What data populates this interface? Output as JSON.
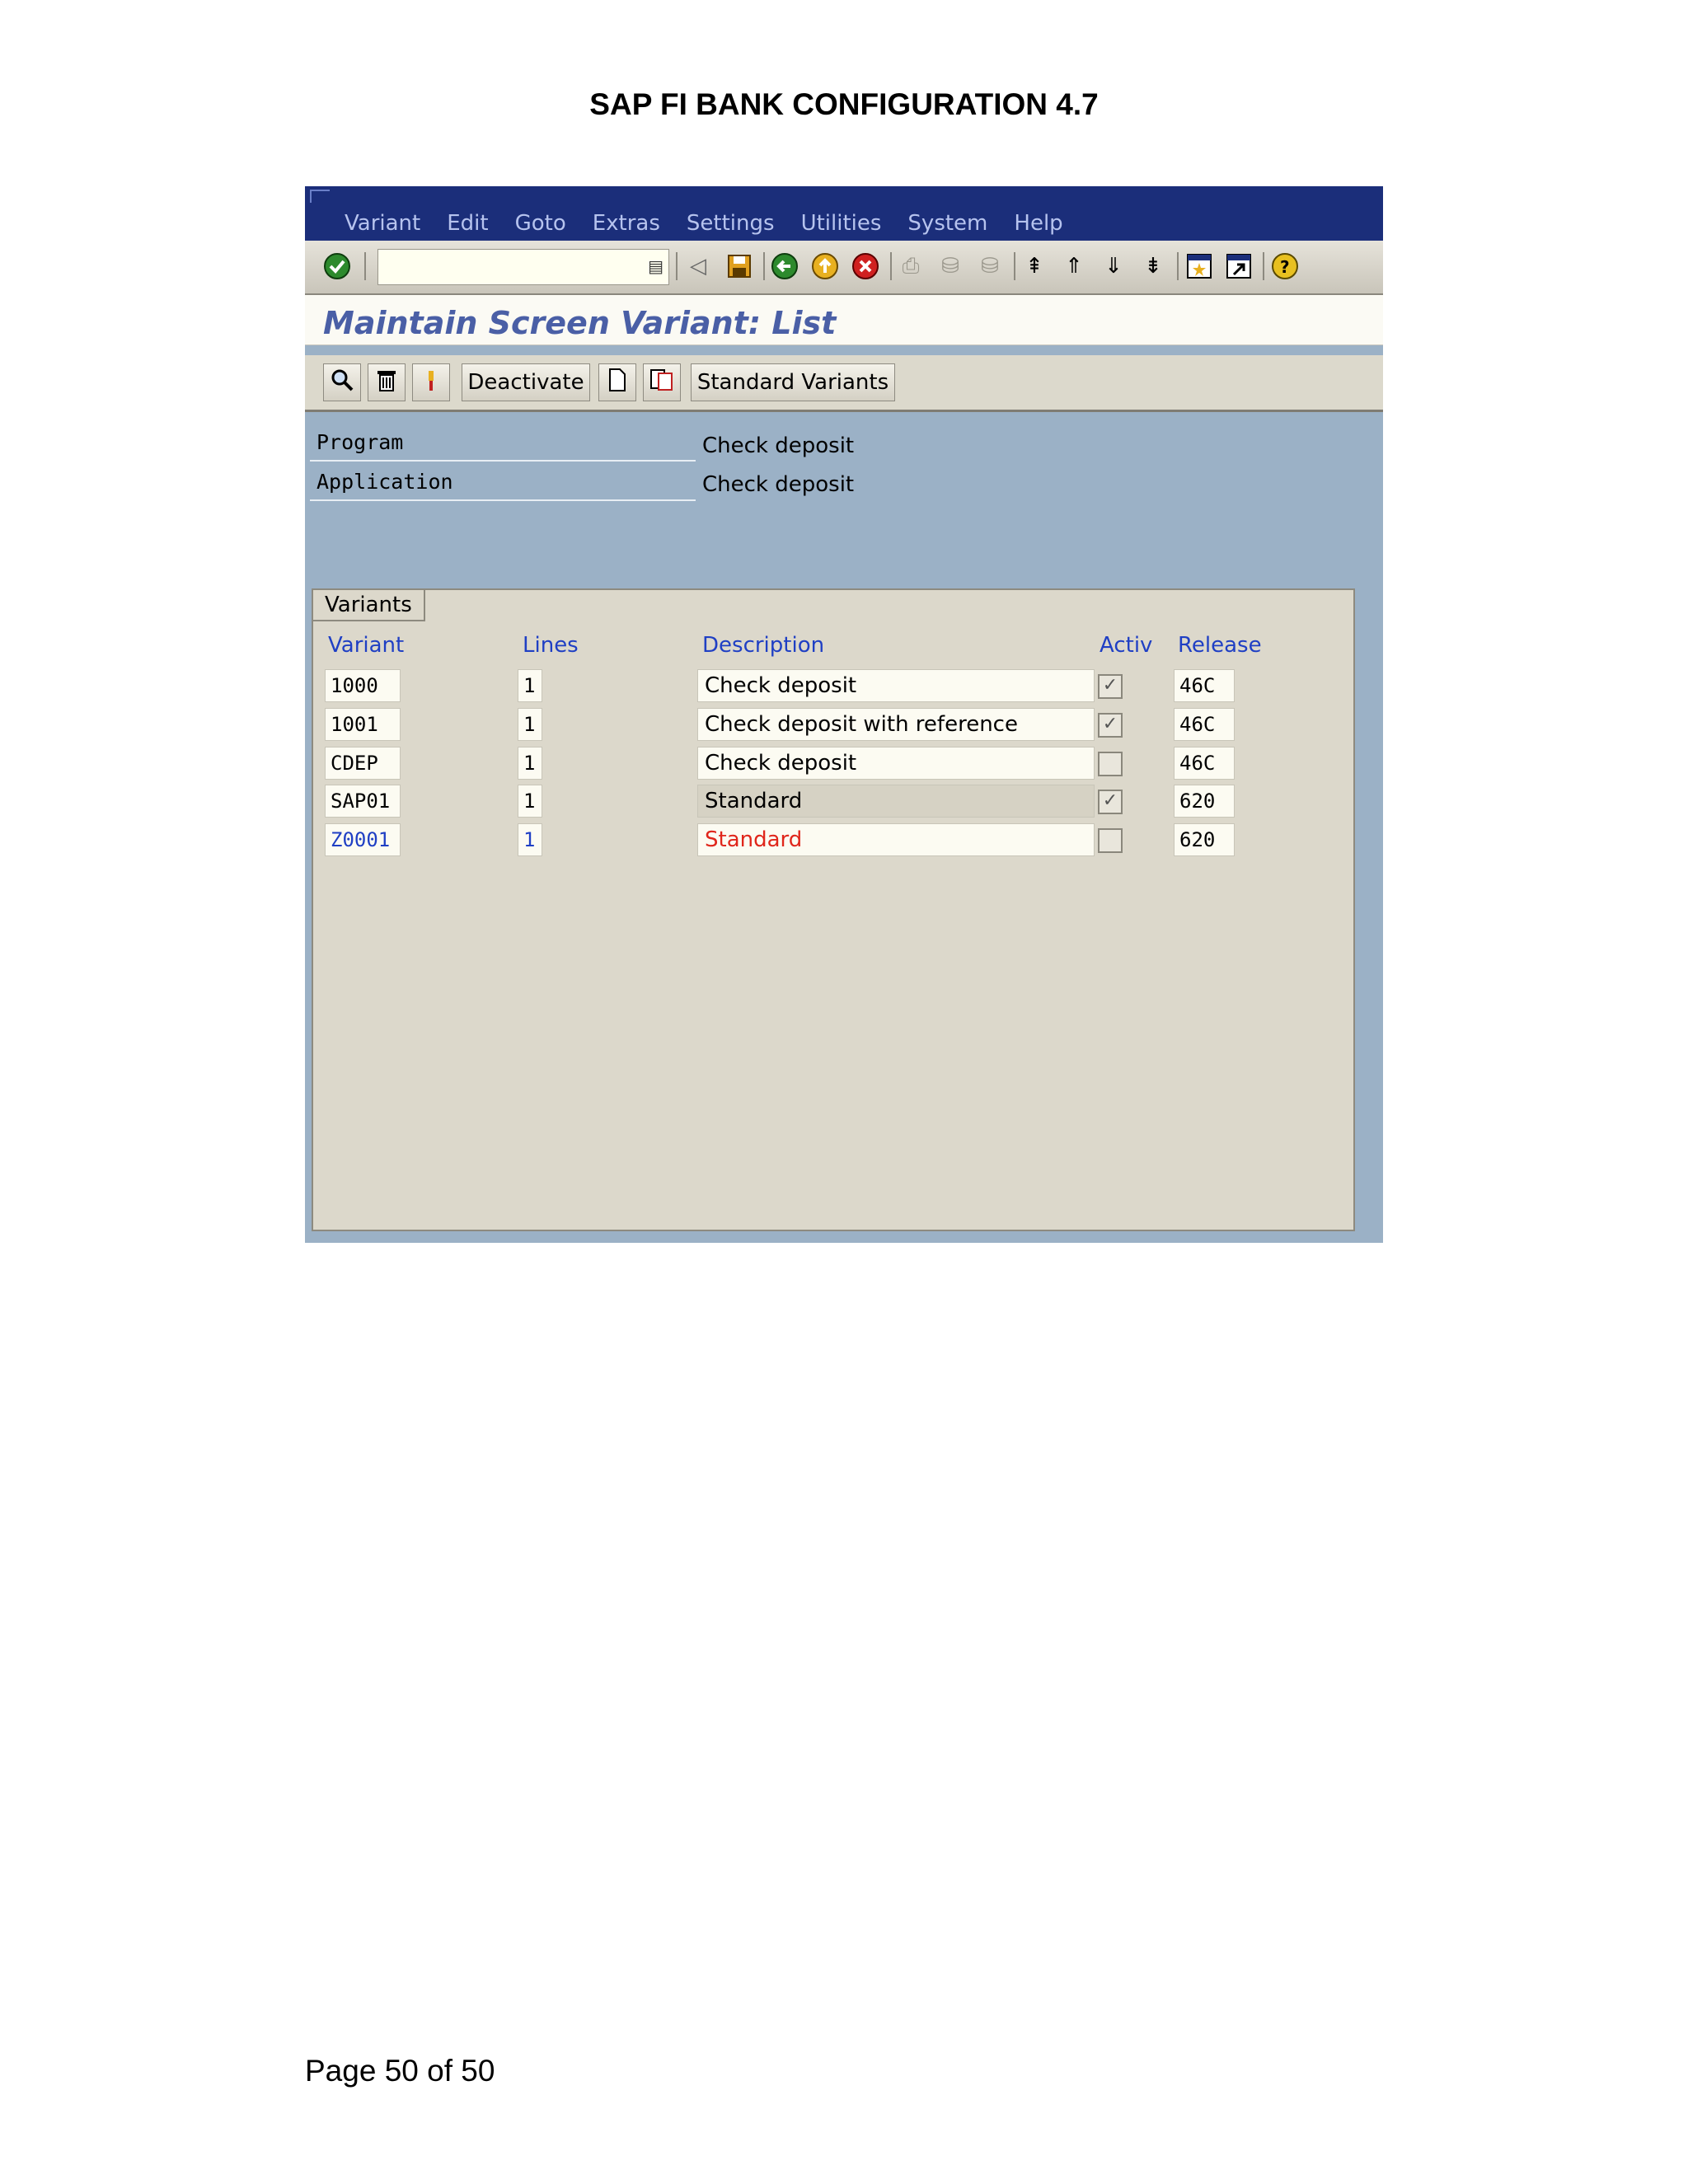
{
  "document": {
    "title": "SAP FI BANK CONFIGURATION 4.7",
    "footer": "Page 50 of 50"
  },
  "sap": {
    "menu": [
      "Variant",
      "Edit",
      "Goto",
      "Extras",
      "Settings",
      "Utilities",
      "System",
      "Help"
    ],
    "screen_title": "Maintain Screen Variant: List",
    "app_toolbar": {
      "deactivate": "Deactivate",
      "standard_variants": "Standard Variants"
    },
    "fields": {
      "program_label": "Program",
      "program_value": "Check deposit",
      "application_label": "Application",
      "application_value": "Check deposit"
    },
    "variants_tab": "Variants",
    "columns": {
      "variant": "Variant",
      "lines": "Lines",
      "description": "Description",
      "activ": "Activ",
      "release": "Release"
    },
    "rows": [
      {
        "variant": "1000",
        "lines": "1",
        "description": "Check deposit",
        "active": true,
        "release": "46C"
      },
      {
        "variant": "1001",
        "lines": "1",
        "description": "Check deposit with reference",
        "active": true,
        "release": "46C"
      },
      {
        "variant": "CDEP",
        "lines": "1",
        "description": "Check deposit",
        "active": false,
        "release": "46C"
      },
      {
        "variant": "SAP01",
        "lines": "1",
        "description": "Standard",
        "active": true,
        "release": "620"
      },
      {
        "variant": "Z0001",
        "lines": "1",
        "description": "Standard",
        "active": false,
        "release": "620"
      }
    ],
    "colors": {
      "menubar": "#1b2e7a",
      "title_text": "#4a5fa6",
      "column_header": "#1f3fc4",
      "highlight_text": "#e0261b"
    }
  }
}
